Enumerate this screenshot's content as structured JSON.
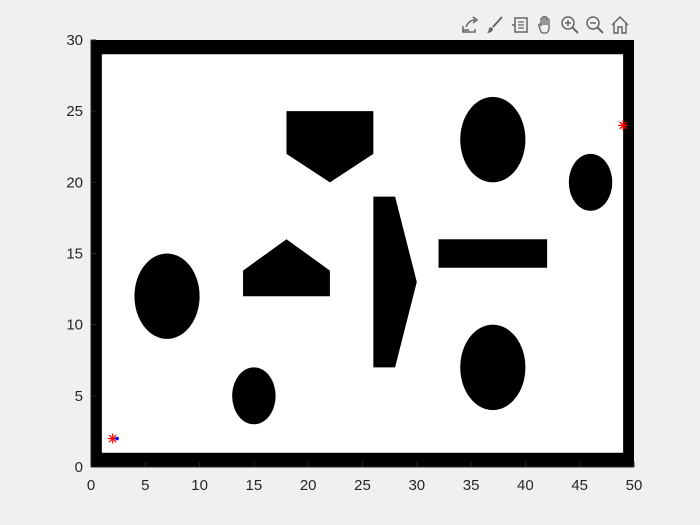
{
  "toolbar": {
    "buttons": [
      {
        "name": "export-icon"
      },
      {
        "name": "brush-icon"
      },
      {
        "name": "datatip-icon"
      },
      {
        "name": "pan-icon"
      },
      {
        "name": "zoom-in-icon"
      },
      {
        "name": "zoom-out-icon"
      },
      {
        "name": "home-icon"
      }
    ]
  },
  "chart_data": {
    "type": "scatter",
    "xlim": [
      0,
      50
    ],
    "ylim": [
      0,
      30
    ],
    "x_ticks": [
      "0",
      "5",
      "10",
      "15",
      "20",
      "25",
      "30",
      "35",
      "40",
      "45",
      "50"
    ],
    "y_ticks": [
      "0",
      "5",
      "10",
      "15",
      "20",
      "25",
      "30"
    ],
    "grid": false,
    "map": {
      "boundary_frame": {
        "x_range": [
          0,
          50
        ],
        "y_range": [
          0,
          30
        ],
        "wall_thickness": 1
      },
      "obstacles": [
        {
          "shape": "ellipse",
          "cx": 7,
          "cy": 12,
          "rx": 3,
          "ry": 3
        },
        {
          "shape": "ellipse",
          "cx": 15,
          "cy": 5,
          "rx": 2,
          "ry": 2
        },
        {
          "shape": "ellipse",
          "cx": 37,
          "cy": 23,
          "rx": 3,
          "ry": 3
        },
        {
          "shape": "ellipse",
          "cx": 37,
          "cy": 7,
          "rx": 3,
          "ry": 3
        },
        {
          "shape": "ellipse",
          "cx": 46,
          "cy": 20,
          "rx": 2,
          "ry": 2
        },
        {
          "shape": "polygon",
          "points": [
            [
              18,
              16
            ],
            [
              22,
              13.8
            ],
            [
              22,
              12
            ],
            [
              14,
              12
            ],
            [
              14,
              13.8
            ]
          ]
        },
        {
          "shape": "polygon",
          "points": [
            [
              18,
              25
            ],
            [
              26,
              25
            ],
            [
              26,
              22
            ],
            [
              22,
              20
            ],
            [
              18,
              22
            ]
          ]
        },
        {
          "shape": "polygon",
          "points": [
            [
              26,
              19
            ],
            [
              28,
              19
            ],
            [
              30,
              13
            ],
            [
              28,
              7
            ],
            [
              26,
              7
            ]
          ]
        },
        {
          "shape": "rect",
          "x": 32,
          "y": 14,
          "w": 10,
          "h": 2
        }
      ],
      "markers": [
        {
          "role": "start",
          "x": 2,
          "y": 2,
          "symbol": "*",
          "color": "#ff0000"
        },
        {
          "role": "start-dot",
          "x": 2.4,
          "y": 2,
          "symbol": ".",
          "color": "#0000ff"
        },
        {
          "role": "goal",
          "x": 49,
          "y": 24,
          "symbol": "*",
          "color": "#ff0000"
        }
      ]
    }
  }
}
